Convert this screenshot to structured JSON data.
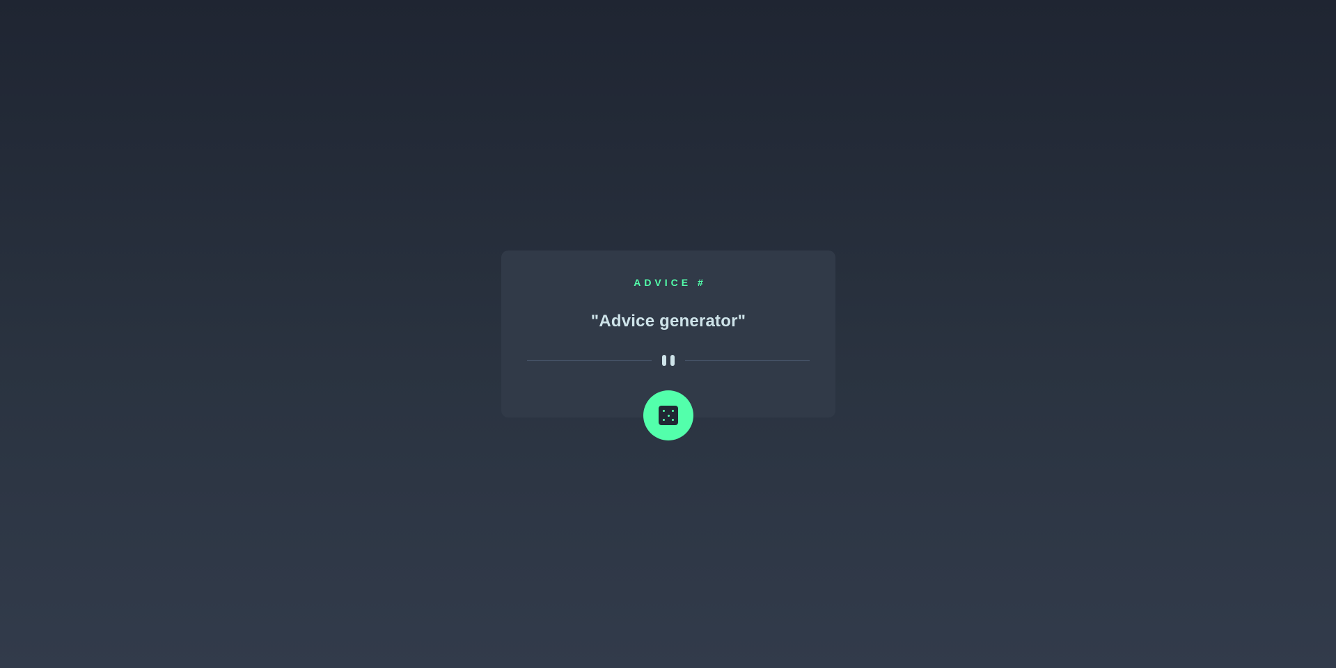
{
  "card": {
    "label": "ADVICE #",
    "quote": "\"Advice generator\""
  },
  "controls": {
    "dice_icon": "dice-icon",
    "divider_icon": "pause-icon"
  },
  "colors": {
    "accent": "#53ffab",
    "card_background": "#313a48",
    "text_light": "#cee3e9",
    "divider": "#4f5d74",
    "dice_face": "#202733"
  }
}
